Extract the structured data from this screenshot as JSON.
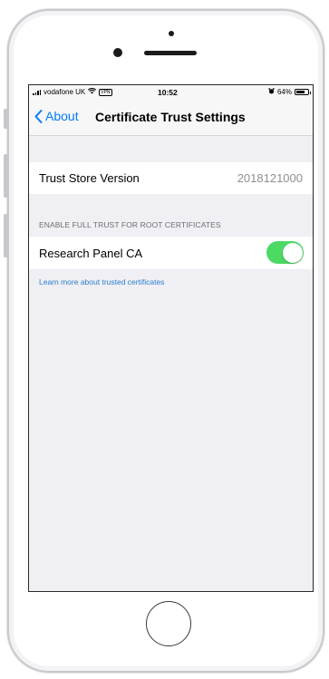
{
  "status_bar": {
    "carrier": "vodafone UK",
    "vpn": "VPN",
    "time": "10:52",
    "battery": "64%"
  },
  "nav": {
    "back_label": "About",
    "title": "Certificate Trust Settings"
  },
  "trust_store": {
    "label": "Trust Store Version",
    "value": "2018121000"
  },
  "full_trust_section": {
    "header": "ENABLE FULL TRUST FOR ROOT CERTIFICATES",
    "items": [
      {
        "label": "Research Panel CA",
        "enabled": true
      }
    ],
    "link": "Learn more about trusted certificates"
  },
  "colors": {
    "accent": "#007aff",
    "toggle_on": "#4cd964",
    "background": "#efeff4"
  },
  "icons": [
    "signal-bars-icon",
    "wifi-icon",
    "alarm-icon",
    "battery-icon",
    "chevron-left-icon"
  ]
}
